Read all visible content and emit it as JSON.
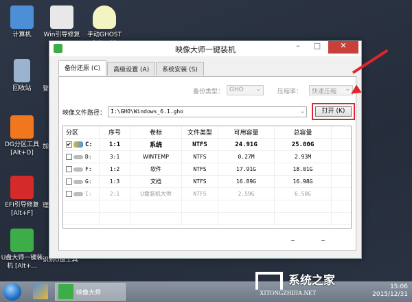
{
  "desktop": {
    "icons": [
      {
        "label": "计算机",
        "color": "#4d8fd6"
      },
      {
        "label": "Win引导修复",
        "color": "#e8e8e8"
      },
      {
        "label": "手动GHOST [Alt+G]",
        "color": "#f4f3c2"
      },
      {
        "label": "回收站",
        "color": "#9ab4d0"
      },
      {
        "label": "DG分区工具 [Alt+D]",
        "color": "#f0771d"
      },
      {
        "label": "EFI引导修复 [Alt+F]",
        "color": "#d42a2a"
      },
      {
        "label": "U盘大师一键装机 [Alt+...",
        "color": "#3cad47"
      }
    ],
    "clipped": [
      "登",
      "加",
      "理",
      "识别U盘工具"
    ]
  },
  "window": {
    "title": "映像大师一键装机",
    "minimize": "–",
    "maximize": "□",
    "close": "✕",
    "tabs": [
      "备份还原 (C)",
      "高级设置 (A)",
      "系统安装 (S)"
    ],
    "backup_type_label": "备份类型：",
    "backup_type": "GHO",
    "compress_label": "压缩率：",
    "compress": "快速压缩",
    "path_label": "映像文件路径：",
    "path": "I:\\GHO\\Windows_6.1.gho",
    "open_button": "打开 (K)",
    "table": {
      "headers": [
        "分区",
        "序号",
        "卷标",
        "文件类型",
        "可用容量",
        "总容量"
      ],
      "rows": [
        {
          "checked": true,
          "drive": "C:",
          "num": "1:1",
          "label": "系统",
          "fs": "NTFS",
          "free": "24.91G",
          "total": "25.00G"
        },
        {
          "checked": false,
          "drive": "D:",
          "num": "3:1",
          "label": "WINTEMP",
          "fs": "NTFS",
          "free": "0.27M",
          "total": "2.93M"
        },
        {
          "checked": false,
          "drive": "F:",
          "num": "1:2",
          "label": "软件",
          "fs": "NTFS",
          "free": "17.91G",
          "total": "18.01G"
        },
        {
          "checked": false,
          "drive": "G:",
          "num": "1:3",
          "label": "文档",
          "fs": "NTFS",
          "free": "16.89G",
          "total": "16.98G"
        },
        {
          "checked": false,
          "drive": "I:",
          "num": "2:1",
          "label": "U盘装机大师",
          "fs": "NTFS",
          "free": "2.59G",
          "total": "6.50G"
        }
      ]
    }
  },
  "taskbar": {
    "app": "映像大师",
    "time": "15:06",
    "date": "2015/12/31"
  },
  "watermark": {
    "text": "系统之家",
    "url": "XITONGZHIJIA.NET"
  },
  "colors": {
    "highlight": "#e0262a",
    "accent": "#3cad47"
  }
}
